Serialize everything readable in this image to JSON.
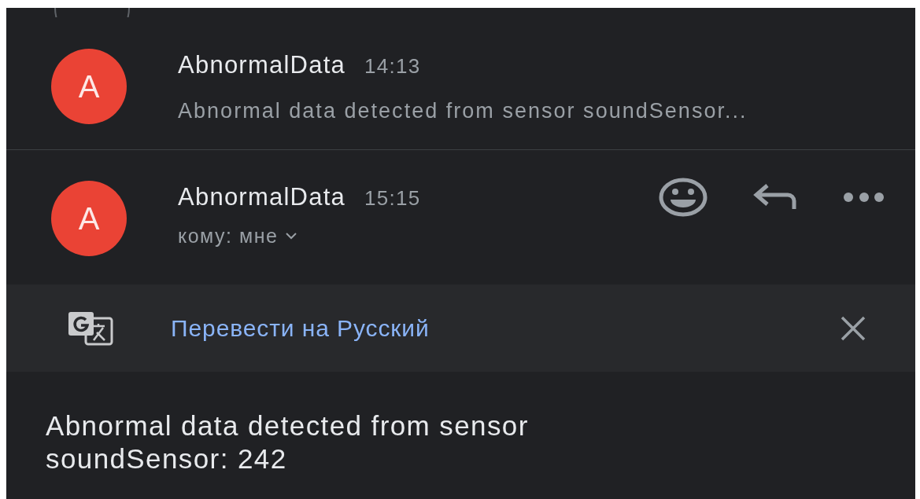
{
  "messages": [
    {
      "kind": "collapsed",
      "avatar_letter": "A",
      "sender": "AbnormalData",
      "time": "14:13",
      "snippet": "Abnormal data detected from sensor soundSensor..."
    },
    {
      "kind": "expanded",
      "avatar_letter": "A",
      "sender": "AbnormalData",
      "time": "15:15",
      "recipient": "кому: мне"
    }
  ],
  "translate_bar": {
    "label": "Перевести на Русский"
  },
  "body": "Abnormal data detected from sensor soundSensor: 242"
}
